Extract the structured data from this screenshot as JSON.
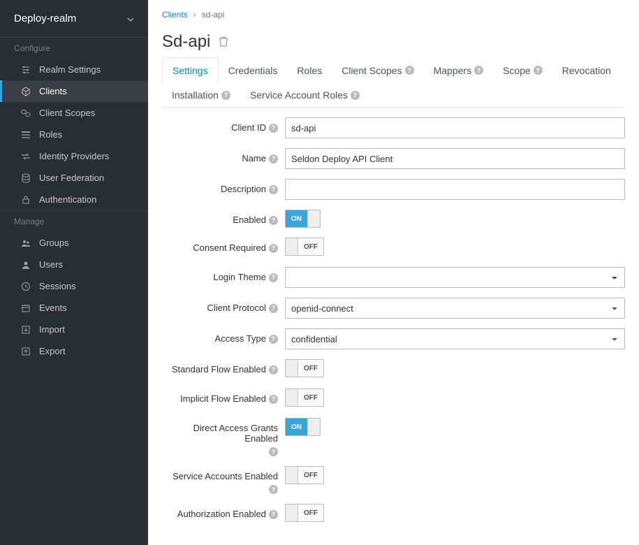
{
  "realm": {
    "name": "Deploy-realm"
  },
  "sidebar": {
    "configure_header": "Configure",
    "manage_header": "Manage",
    "configure": [
      {
        "label": "Realm Settings",
        "icon": "sliders-icon"
      },
      {
        "label": "Clients",
        "icon": "cube-icon"
      },
      {
        "label": "Client Scopes",
        "icon": "cubes-icon"
      },
      {
        "label": "Roles",
        "icon": "list-icon"
      },
      {
        "label": "Identity Providers",
        "icon": "exchange-icon"
      },
      {
        "label": "User Federation",
        "icon": "database-icon"
      },
      {
        "label": "Authentication",
        "icon": "lock-icon"
      }
    ],
    "manage": [
      {
        "label": "Groups",
        "icon": "group-icon"
      },
      {
        "label": "Users",
        "icon": "user-icon"
      },
      {
        "label": "Sessions",
        "icon": "clock-icon"
      },
      {
        "label": "Events",
        "icon": "calendar-icon"
      },
      {
        "label": "Import",
        "icon": "import-icon"
      },
      {
        "label": "Export",
        "icon": "export-icon"
      }
    ]
  },
  "breadcrumb": {
    "parent": "Clients",
    "current": "sd-api"
  },
  "page": {
    "title": "Sd-api"
  },
  "tabs": [
    {
      "label": "Settings",
      "help": false,
      "active": true
    },
    {
      "label": "Credentials",
      "help": false
    },
    {
      "label": "Roles",
      "help": false
    },
    {
      "label": "Client Scopes",
      "help": true
    },
    {
      "label": "Mappers",
      "help": true
    },
    {
      "label": "Scope",
      "help": true
    },
    {
      "label": "Revocation",
      "help": false
    },
    {
      "label": "Installation",
      "help": true
    },
    {
      "label": "Service Account Roles",
      "help": true
    }
  ],
  "form": {
    "client_id": {
      "label": "Client ID",
      "value": "sd-api"
    },
    "name": {
      "label": "Name",
      "value": "Seldon Deploy API Client"
    },
    "description": {
      "label": "Description",
      "value": ""
    },
    "enabled": {
      "label": "Enabled",
      "value": true,
      "on": "ON",
      "off": "OFF"
    },
    "consent_required": {
      "label": "Consent Required",
      "value": false,
      "on": "ON",
      "off": "OFF"
    },
    "login_theme": {
      "label": "Login Theme",
      "value": ""
    },
    "client_protocol": {
      "label": "Client Protocol",
      "value": "openid-connect"
    },
    "access_type": {
      "label": "Access Type",
      "value": "confidential"
    },
    "standard_flow": {
      "label": "Standard Flow Enabled",
      "value": false,
      "on": "ON",
      "off": "OFF"
    },
    "implicit_flow": {
      "label": "Implicit Flow Enabled",
      "value": false,
      "on": "ON",
      "off": "OFF"
    },
    "direct_access": {
      "label": "Direct Access Grants Enabled",
      "value": true,
      "on": "ON",
      "off": "OFF"
    },
    "service_accounts": {
      "label": "Service Accounts Enabled",
      "value": false,
      "on": "ON",
      "off": "OFF"
    },
    "authorization": {
      "label": "Authorization Enabled",
      "value": false,
      "on": "ON",
      "off": "OFF"
    }
  }
}
